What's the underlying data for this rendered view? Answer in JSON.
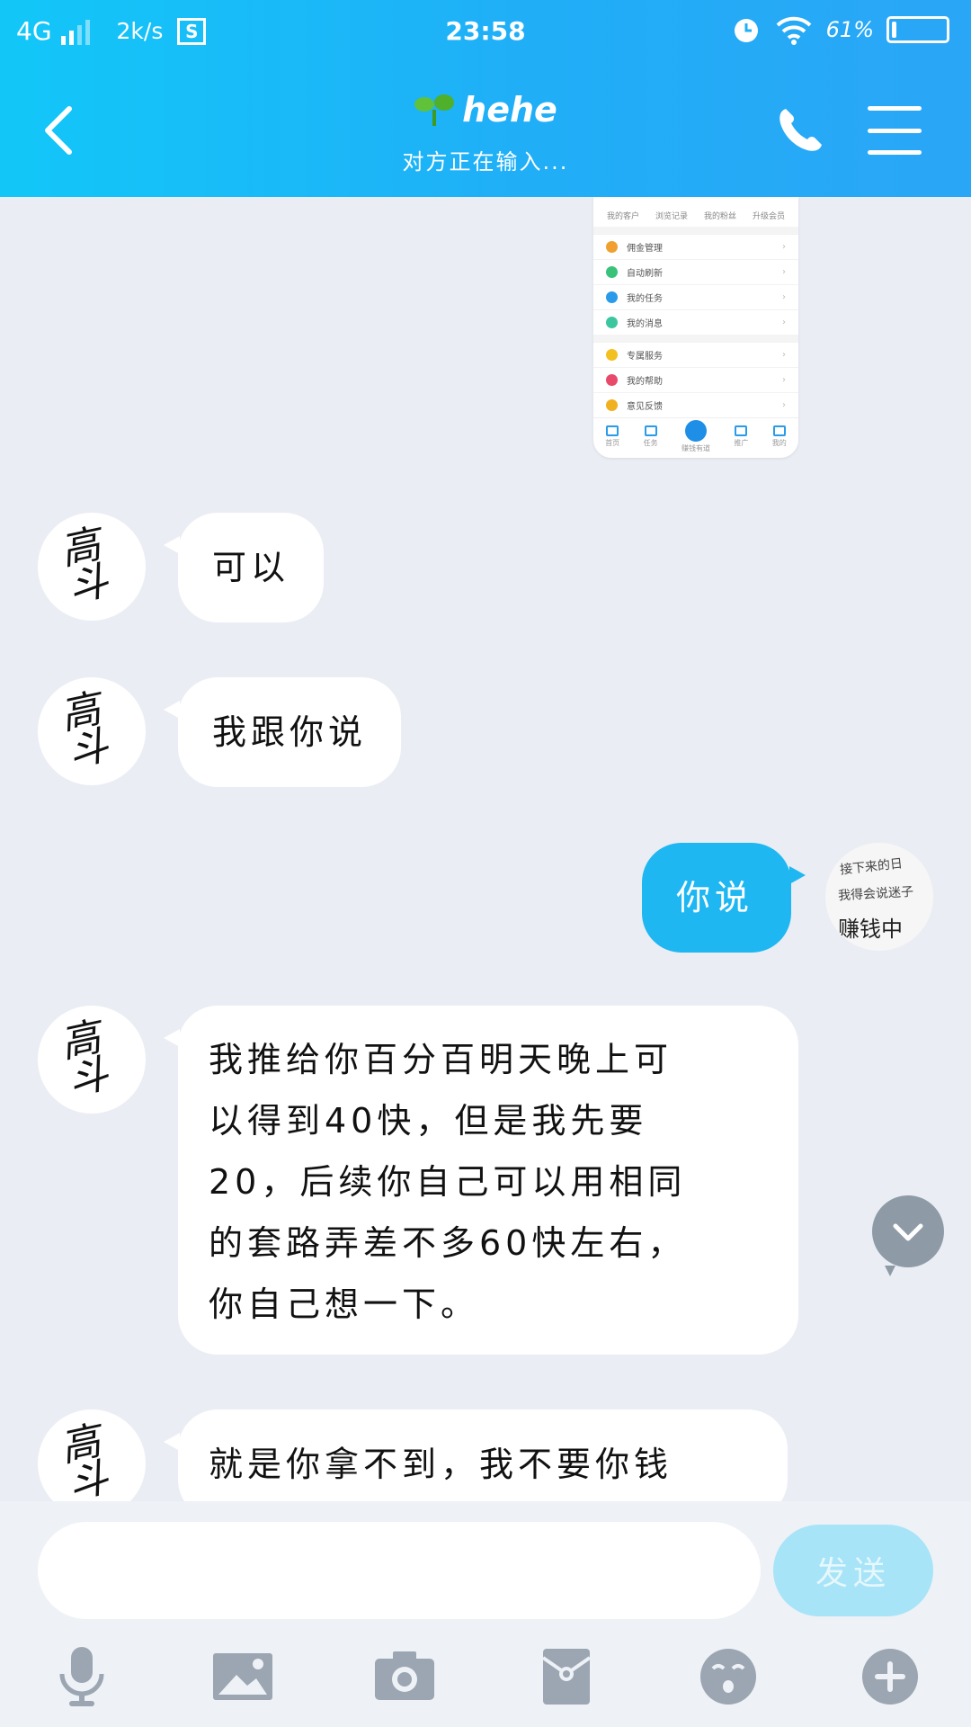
{
  "status_bar": {
    "network": "4G",
    "speed": "2k/s",
    "screenshot_badge": "S",
    "time": "23:58",
    "battery_pct": "61%"
  },
  "header": {
    "title": "hehe",
    "subtitle": "对方正在输入...",
    "back_icon": "chevron-left-icon",
    "call_icon": "phone-icon",
    "menu_icon": "hamburger-menu-icon",
    "gradient_colors": [
      "#12c7f8",
      "#2aa6f6"
    ]
  },
  "screenshot_card": {
    "top_labels": [
      "我的客户",
      "浏览记录",
      "我的粉丝",
      "升级会员"
    ],
    "rows_group1": [
      "佣金管理",
      "自动刷新",
      "我的任务",
      "我的消息"
    ],
    "rows_group2": [
      "专属服务",
      "我的帮助",
      "意见反馈"
    ],
    "tabs": [
      "首页",
      "任务",
      "赚钱有道",
      "推广",
      "我的"
    ]
  },
  "messages": [
    {
      "side": "in",
      "text": "可以"
    },
    {
      "side": "in",
      "text": "我跟你说"
    },
    {
      "side": "out",
      "text": "你说"
    },
    {
      "side": "in",
      "lines": [
        "我推给你百分百明天晚上可",
        "以得到40快，但是我先要",
        "20，后续你自己可以用相同",
        "的套路弄差不多60快左右，",
        "你自己想一下。"
      ]
    },
    {
      "side": "in",
      "text": "就是你拿不到，我不要你钱"
    }
  ],
  "avatars": {
    "contact_calligraphy": [
      "高",
      "斗"
    ],
    "self_lines": [
      "接下来的日",
      "我得会说迷子",
      "赚钱中"
    ]
  },
  "input": {
    "placeholder": "",
    "send_label": "发送"
  },
  "toolbar": [
    "microphone-icon",
    "image-icon",
    "camera-icon",
    "red-packet-icon",
    "emoji-icon",
    "plus-icon"
  ],
  "colors": {
    "outgoing_bubble": "#1eb7f2",
    "incoming_bubble": "#ffffff",
    "chat_background": "#eaedf4",
    "send_button": "#a7e4f7",
    "toolbar_icon": "#9ba6b2"
  }
}
